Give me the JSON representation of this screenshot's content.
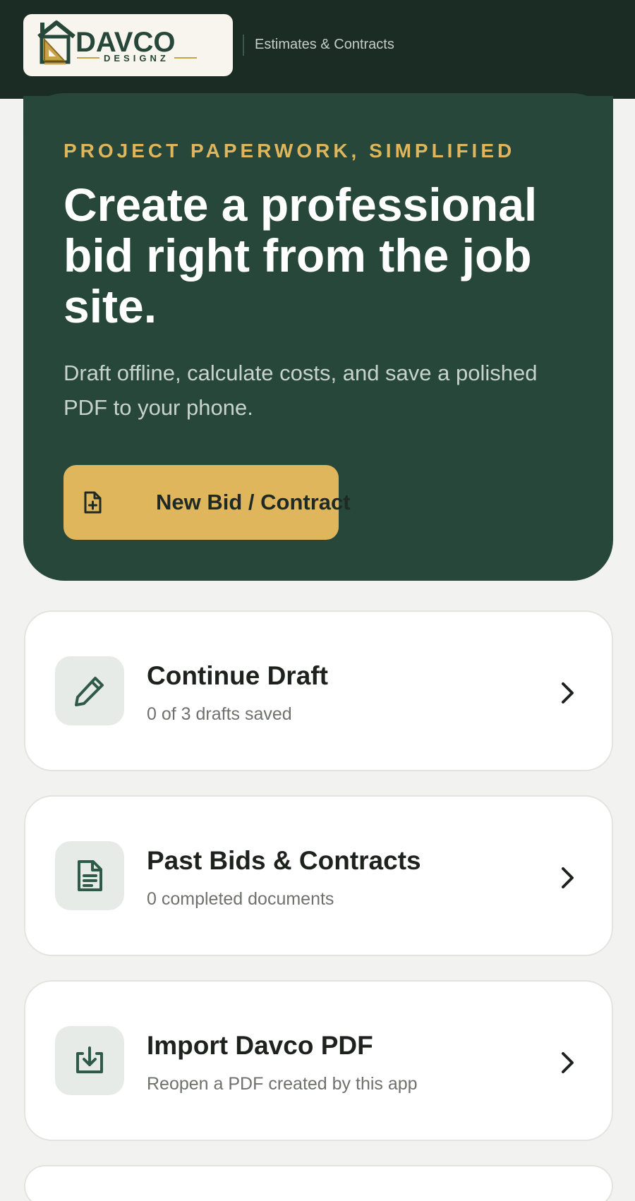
{
  "header": {
    "logo": {
      "wordmark": "DAVCO",
      "tagline": "DESIGNZ"
    },
    "subtitle": "Estimates & Contracts"
  },
  "hero": {
    "eyebrow": "PROJECT PAPERWORK, SIMPLIFIED",
    "title": "Create a professional bid right from the job site.",
    "description": "Draft offline, calculate costs, and save a polished PDF to your phone.",
    "cta_label": "New Bid / Contract",
    "cta_icon": "file-plus-icon"
  },
  "cards": [
    {
      "title": "Continue Draft",
      "subtitle": "0 of 3 drafts saved",
      "icon": "pencil-icon"
    },
    {
      "title": "Past Bids & Contracts",
      "subtitle": "0 completed documents",
      "icon": "document-icon"
    },
    {
      "title": "Import Davco PDF",
      "subtitle": "Reopen a PDF created by this app",
      "icon": "download-icon"
    }
  ],
  "colors": {
    "header_bg": "#1b2c24",
    "hero_bg": "#264739",
    "accent_gold": "#dfb65c",
    "page_bg": "#f2f2f0",
    "icon_green": "#2f5a47"
  }
}
